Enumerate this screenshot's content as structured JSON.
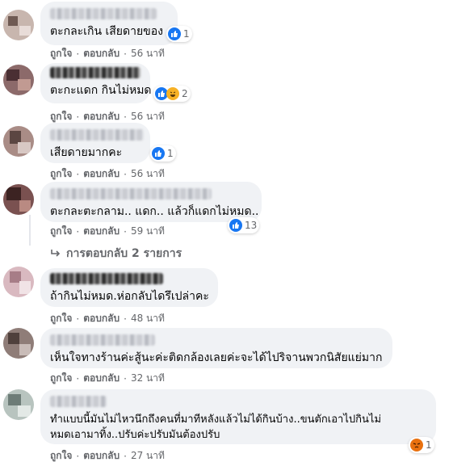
{
  "labels": {
    "like": "ถูกใจ",
    "reply": "ตอบกลับ",
    "separator": "·"
  },
  "comments": [
    {
      "text": "ตะกละเกิน เสียดายของ",
      "reaction_count": "1",
      "time": "56 นาที"
    },
    {
      "text": "ตะกะแดก กินไม่หมด",
      "reaction_count": "2",
      "time": "56 นาที"
    },
    {
      "text": "เสียดายมากคะ",
      "reaction_count": "1",
      "time": "56 นาที"
    },
    {
      "text": "ตะกละตะกลาม.. แดก.. แล้วก็แดกไม่หมด..",
      "reaction_count": "13",
      "time": "59 นาที"
    },
    {
      "text": "ถ้ากินไม่หมด.ห่อกลับไดรึเปล่าคะ",
      "time": "48 นาที"
    },
    {
      "text": "เห็นใจทางร้านค่ะสู้นะค่ะติดกล้องเลยค่ะจะได้ไปริจานพวกนิสัยแย่มาก",
      "time": "32 นาที"
    },
    {
      "text_line1": "ทำแบบนี้มันไม่ไหวนึกถึงคนที่มาทีหลังแล้วไม่ได้กินบ้าง..ขนตักเอาไปกินไม่",
      "text_line2": "หมดเอามาทิ้ง..ปรับค่ะปรับมันต้องปรับ",
      "reaction_count": "1",
      "time": "27 นาที"
    }
  ],
  "view_replies": "การตอบกลับ 2 รายการ",
  "colors": {
    "bubble": "#f0f2f5",
    "meta": "#65676b",
    "like_blue": "#1877f2"
  },
  "icons": {
    "like": "like-icon",
    "haha": "haha-icon",
    "angry": "angry-icon",
    "reply_arrow": "reply-arrow-icon"
  }
}
